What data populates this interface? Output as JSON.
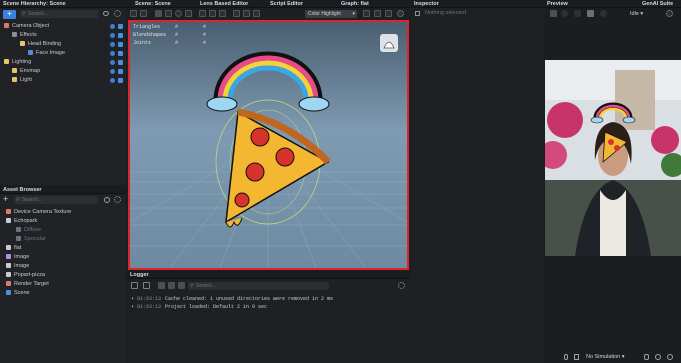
{
  "scene_hierarchy": {
    "title": "Scene Hierarchy: Scene",
    "search_placeholder": "Search...",
    "items": [
      {
        "label": "Camera Object",
        "indent": 0,
        "color": "#e07a5f"
      },
      {
        "label": "Effects",
        "indent": 1,
        "color": "#8a8f98"
      },
      {
        "label": "Head Binding",
        "indent": 2,
        "color": "#e8c46a"
      },
      {
        "label": "Face Image",
        "indent": 3,
        "color": "#4a8fe0"
      },
      {
        "label": "Lighting",
        "indent": 0,
        "color": "#e8c46a"
      },
      {
        "label": "Envmap",
        "indent": 1,
        "color": "#e8c46a"
      },
      {
        "label": "Light",
        "indent": 1,
        "color": "#e8c46a"
      }
    ]
  },
  "asset_browser": {
    "title": "Asset Browser",
    "search_placeholder": "Search...",
    "items": [
      {
        "label": "Device Camera Texture",
        "indent": 0,
        "color": "#e07a5f",
        "dim": false
      },
      {
        "label": "Echopark",
        "indent": 0,
        "color": "#c8ccd2",
        "dim": false
      },
      {
        "label": "Diffuse",
        "indent": 1,
        "color": "#6e737b",
        "dim": true
      },
      {
        "label": "Specular",
        "indent": 1,
        "color": "#6e737b",
        "dim": true
      },
      {
        "label": "flat",
        "indent": 0,
        "color": "#c8ccd2",
        "dim": false
      },
      {
        "label": "Image",
        "indent": 0,
        "color": "#b48ce8",
        "dim": false
      },
      {
        "label": "Image",
        "indent": 0,
        "color": "#c8ccd2",
        "dim": false
      },
      {
        "label": "Popart-pizza",
        "indent": 0,
        "color": "#c8ccd2",
        "dim": false
      },
      {
        "label": "Render Target",
        "indent": 0,
        "color": "#e07a5f",
        "dim": false
      },
      {
        "label": "Scene",
        "indent": 0,
        "color": "#4a8fe0",
        "dim": false
      }
    ]
  },
  "scene_view": {
    "title": "Scene: Scene",
    "stats": [
      {
        "label": "Triangles",
        "value": "#"
      },
      {
        "label": "Blendshapes",
        "value": "#"
      },
      {
        "label": "Joints",
        "value": "#"
      }
    ]
  },
  "lens_editor": {
    "title": "Lens Based Editor"
  },
  "script_editor": {
    "title": "Script Editor"
  },
  "graph": {
    "title": "Graph: flat",
    "mode": "Color Highlight"
  },
  "inspector": {
    "title": "Inspector",
    "empty_text": "Nothing selected"
  },
  "logger": {
    "title": "Logger",
    "search_placeholder": "Search...",
    "lines": [
      {
        "time": "01:03:13",
        "text": "Cache cleaned: 1 unused directories were removed in 2 ms"
      },
      {
        "time": "01:03:13",
        "text": "Project loaded: Default 2 in 0 sec"
      }
    ]
  },
  "preview": {
    "title": "Preview",
    "simulation": "No Simulation"
  },
  "genai": {
    "title": "GenAI Suite",
    "state": "Idle"
  },
  "colors": {
    "accent": "#4a8fe0",
    "highlight_border": "#e0242b"
  }
}
